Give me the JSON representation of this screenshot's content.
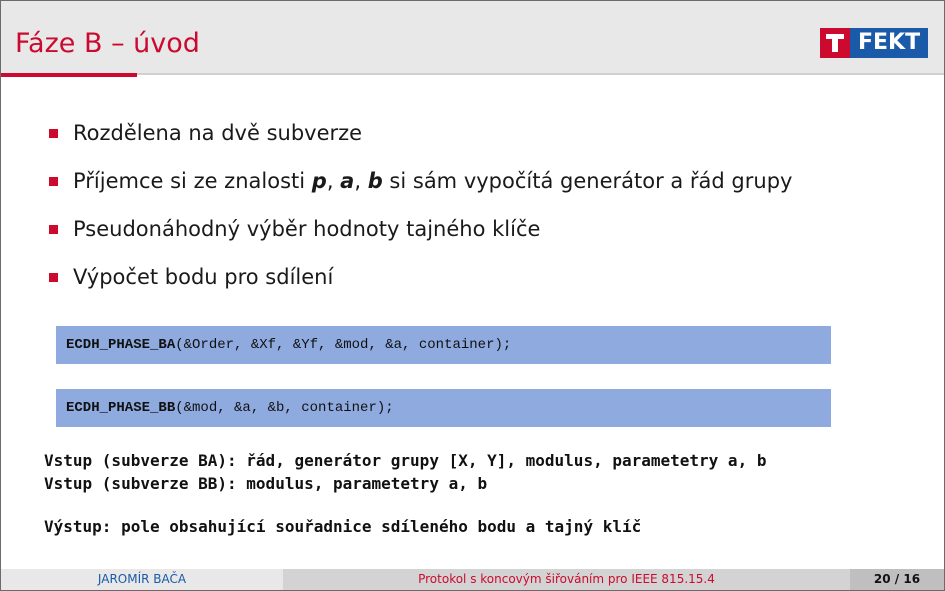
{
  "slide": {
    "title": "Fáze B – úvod",
    "logo_text": "FEKT"
  },
  "bullets": {
    "b0": "Rozdělena na dvě subverze",
    "b1_pre": "Příjemce si ze znalosti ",
    "b1_p": "p",
    "b1_sep1": ", ",
    "b1_a": "a",
    "b1_sep2": ", ",
    "b1_b": "b",
    "b1_post": " si sám vypočítá generátor a řád grupy",
    "b2": "Pseudonáhodný výběr hodnoty tajného klíče",
    "b3": "Výpočet bodu pro sdílení"
  },
  "code": {
    "ba_func": "ECDH_PHASE_BA",
    "ba_args": "(&Order, &Xf, &Yf, &mod, &a, container);",
    "bb_func": "ECDH_PHASE_BB",
    "bb_args": "(&mod, &a, &b, container);"
  },
  "io": {
    "input_ba": "Vstup (subverze BA): řád, generátor grupy [X, Y], modulus, parametetry a, b",
    "input_bb": "Vstup (subverze BB): modulus, parametetry a, b",
    "output": "Výstup: pole obsahující souřadnice sdíleného bodu a tajný klíč"
  },
  "footer": {
    "author": "JAROMÍR BAČA",
    "talk": "Protokol s koncovým šiřováním pro IEEE 815.15.4",
    "page": "20 / 16"
  },
  "colors": {
    "accent_red": "#cc0a2f",
    "brand_blue": "#1a5aa8",
    "code_box": "#8eaadf"
  }
}
